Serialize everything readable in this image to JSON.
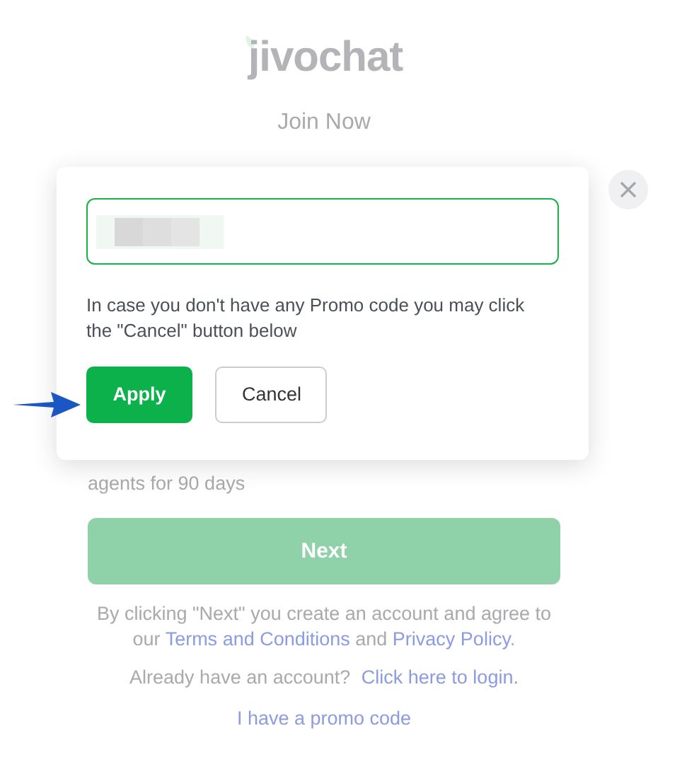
{
  "logo": {
    "text": "jivochat"
  },
  "heading": "Join Now",
  "background_text": "agents for 90 days",
  "next_button": {
    "label": "Next",
    "disabled": true
  },
  "legal": [
    {
      "kind": "text",
      "text": "By clicking \"Next\" you create an account and agree to our "
    },
    {
      "kind": "link",
      "text": "Terms and Conditions"
    },
    {
      "kind": "text",
      "text": " and "
    },
    {
      "kind": "link",
      "text": "Privacy Policy"
    },
    {
      "kind": "text",
      "text": "."
    }
  ],
  "login": {
    "text": "Already have an account?",
    "link": "Click here to login."
  },
  "promo_link": "I have a promo code",
  "modal": {
    "hint": "In case you don't have any Promo code you may click the \"Cancel\" button below",
    "buttons": [
      {
        "label": "Apply",
        "kind": "primary"
      },
      {
        "label": "Cancel",
        "kind": "secondary"
      }
    ]
  }
}
